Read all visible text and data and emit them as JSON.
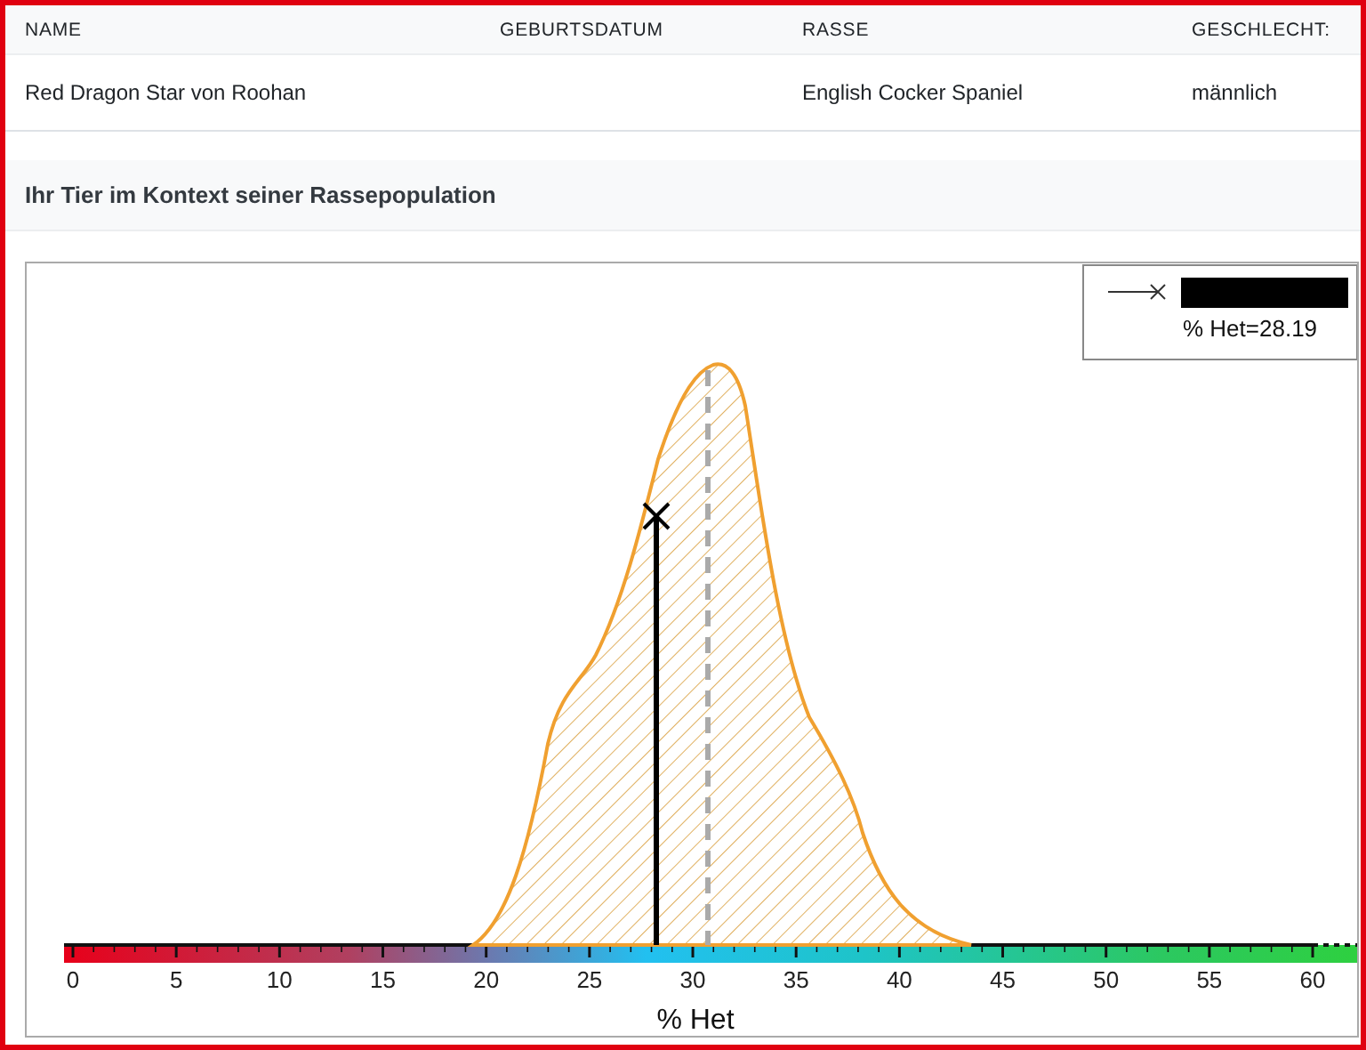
{
  "table": {
    "columns": [
      {
        "heading": "NAME",
        "value": "Red Dragon Star von Roohan"
      },
      {
        "heading": "GEBURTSDATUM"
      },
      {
        "heading": "RASSE",
        "value": "English Cocker Spaniel"
      },
      {
        "heading": "GESCHLECHT:",
        "value": "männlich"
      }
    ]
  },
  "section": {
    "title": "Ihr Tier im Kontext seiner Rassepopulation"
  },
  "chart": {
    "legend": {
      "label": "% Het=28.19"
    },
    "xticks": [
      "0",
      "5",
      "10",
      "15",
      "20",
      "25",
      "30",
      "35",
      "40",
      "45",
      "50",
      "55",
      "60"
    ],
    "xlabel": "% Het"
  }
}
